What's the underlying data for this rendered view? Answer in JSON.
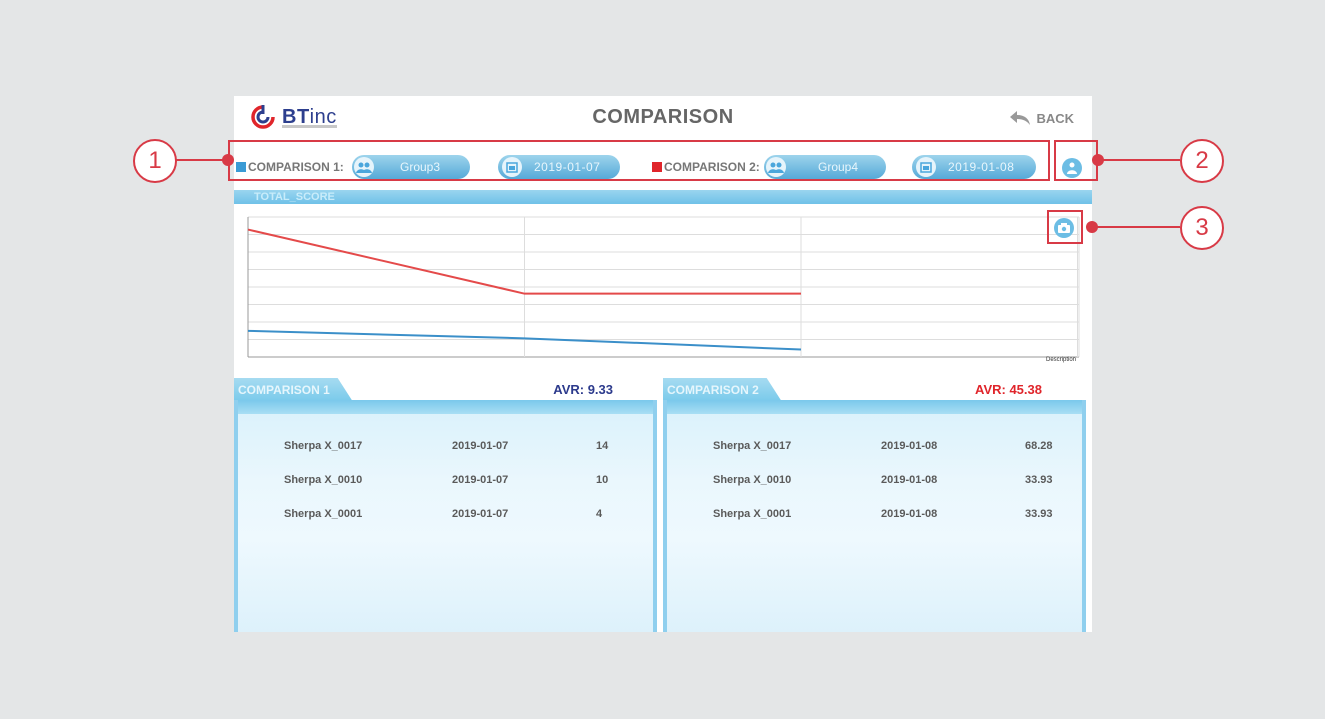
{
  "header": {
    "logo_text": "BT",
    "logo_inc": "inc",
    "title": "COMPARISON",
    "back_label": "BACK"
  },
  "comparison1": {
    "label": "COMPARISON 1:",
    "group": "Group3",
    "date": "2019-01-07",
    "color": "#3a9bd5"
  },
  "comparison2": {
    "label": "COMPARISON 2:",
    "group": "Group4",
    "date": "2019-01-08",
    "color": "#e0252b"
  },
  "section": {
    "title": "TOTAL_SCORE"
  },
  "chart_data": {
    "type": "line",
    "xlabel": "Description",
    "series": [
      {
        "values": [
          68.28,
          33.93,
          33.93
        ],
        "color": "#e44a4a"
      },
      {
        "values": [
          14,
          10,
          4
        ],
        "color": "#3b8fc9"
      }
    ],
    "ylim": [
      0,
      75
    ],
    "grid": true
  },
  "panel1": {
    "tab": "COMPARISON 1",
    "avr": "AVR: 9.33",
    "avr_color": "#2c3a8c",
    "rows": [
      {
        "name": "Sherpa X_0017",
        "date": "2019-01-07",
        "score": "14"
      },
      {
        "name": "Sherpa X_0010",
        "date": "2019-01-07",
        "score": "10"
      },
      {
        "name": "Sherpa X_0001",
        "date": "2019-01-07",
        "score": "4"
      }
    ]
  },
  "panel2": {
    "tab": "COMPARISON 2",
    "avr": "AVR: 45.38",
    "avr_color": "#e0252b",
    "rows": [
      {
        "name": "Sherpa X_0017",
        "date": "2019-01-08",
        "score": "68.28"
      },
      {
        "name": "Sherpa X_0010",
        "date": "2019-01-08",
        "score": "33.93"
      },
      {
        "name": "Sherpa X_0001",
        "date": "2019-01-08",
        "score": "33.93"
      }
    ]
  },
  "callouts": {
    "one": "1",
    "two": "2",
    "three": "3"
  }
}
